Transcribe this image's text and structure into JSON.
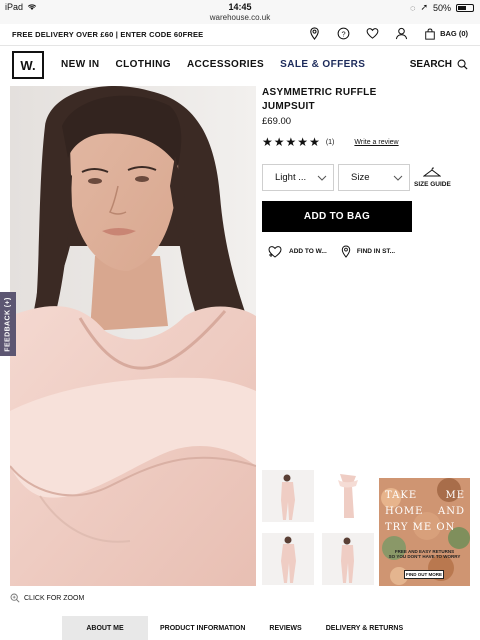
{
  "status": {
    "device": "iPad",
    "time": "14:45",
    "url": "warehouse.co.uk",
    "battery_text": "50%",
    "battery_level": 0.5
  },
  "promo": {
    "text": "FREE DELIVERY OVER £60 | ENTER CODE 60FREE",
    "bag_label": "BAG (0)"
  },
  "nav": {
    "logo": "W.",
    "items": [
      "NEW IN",
      "CLOTHING",
      "ACCESSORIES",
      "SALE & OFFERS"
    ],
    "search_label": "SEARCH",
    "sale_color": "#1c2a5a"
  },
  "feedback": {
    "label": "FEEDBACK (+)"
  },
  "zoom": {
    "label": "CLICK FOR ZOOM"
  },
  "product": {
    "title_line1": "ASYMMETRIC RUFFLE",
    "title_line2": "JUMPSUIT",
    "price": "£69.00",
    "stars": 5,
    "review_count": "(1)",
    "write_review": "Write a review",
    "colour_select": "Light ...",
    "size_select": "Size",
    "size_guide": "SIZE GUIDE",
    "add_to_bag": "ADD TO BAG",
    "add_to_wishlist": "ADD TO W...",
    "find_in_store": "FIND IN ST..."
  },
  "ad": {
    "line1": [
      "TAKE",
      "ME"
    ],
    "line2": [
      "HOME",
      "AND"
    ],
    "line3": [
      "TRY ME ON"
    ],
    "sub1": "FREE AND EASY RETURNS",
    "sub2": "SO YOU DON'T HAVE TO WORRY",
    "cta": "FIND OUT MORE"
  },
  "tabs": [
    "ABOUT ME",
    "PRODUCT INFORMATION",
    "REVIEWS",
    "DELIVERY & RETURNS"
  ],
  "colors": {
    "accent": "#000000",
    "feedback_bg": "#5c5672",
    "blush": "#efcdc4"
  }
}
